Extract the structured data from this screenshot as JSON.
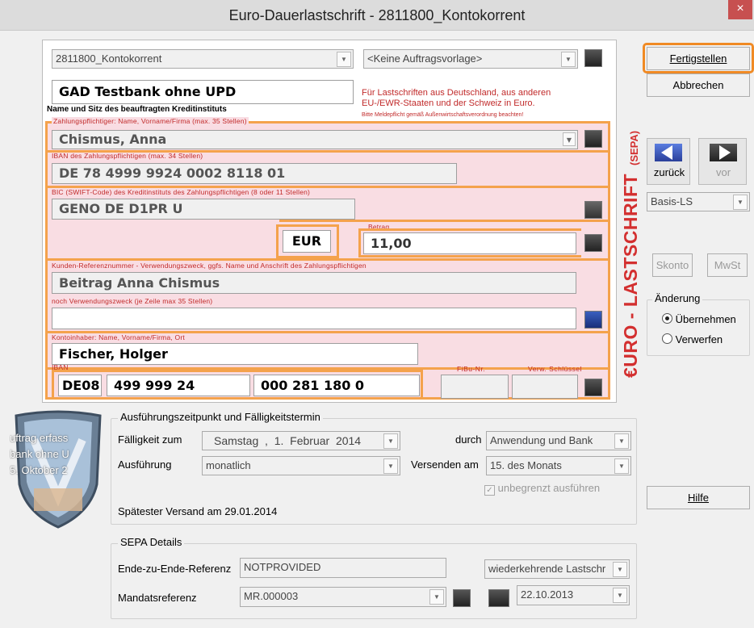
{
  "window": {
    "title": "Euro-Dauerlastschrift - 2811800_Kontokorrent",
    "close_label": "×"
  },
  "form": {
    "account_select": "2811800_Kontokorrent",
    "template_select": "<Keine Auftragsvorlage>",
    "bank_name": "GAD Testbank ohne UPD",
    "bank_label": "Name und Sitz des beauftragten Kreditinstituts",
    "info_line1": "Für Lastschriften aus Deutschland, aus anderen",
    "info_line2": "EU-/EWR-Staaten und der Schweiz in Euro.",
    "info_line3": "Bitte Meldepflicht gemäß Außenwirtschaftsverordnung beachten!",
    "payer_label": "Zahlungspflichtiger: Name, Vorname/Firma (max. 35 Stellen)",
    "payer_name": "Chismus, Anna",
    "iban_payer_label": "IBAN des Zahlungspflichtigen (max. 34 Stellen)",
    "iban_payer": "DE 78 4999 9924 0002 8118 01",
    "bic_label": "BIC (SWIFT-Code) des Kreditinstituts des Zahlungspflichtigen (8 oder 11 Stellen)",
    "bic": "GENO DE D1PR U",
    "currency": "EUR",
    "amount_label": "Betrag",
    "amount": "11,00",
    "ref_label": "Kunden-Referenznummer - Verwendungszweck, ggfs. Name und Anschrift des Zahlungspflichtigen",
    "ref_value": "Beitrag Anna Chismus",
    "purpose2_label": "noch Verwendungszweck (je Zeile max 35 Stellen)",
    "purpose2_value": "",
    "holder_label": "Kontoinhaber: Name, Vorname/Firma, Ort",
    "holder_value": "Fischer, Holger",
    "iban_label": "IBAN",
    "iban_part1": "DE08",
    "iban_part2": "499 999 24",
    "iban_part3": "000 281 180 0",
    "fibu_label": "FiBu-Nr.",
    "verw_label": "Verw. Schlüssel",
    "vertical_title": "€URO - LASTSCHRIFT",
    "vertical_sepa": "(SEPA)"
  },
  "right": {
    "finish_label": "Fertigstellen",
    "cancel_label": "Abbrechen",
    "back_label": "zurück",
    "next_label": "vor",
    "type_select": "Basis-LS",
    "skonto_label": "Skonto",
    "mwst_label": "MwSt",
    "change_legend": "Änderung",
    "radio_apply": "Übernehmen",
    "radio_discard": "Verwerfen",
    "help_label": "Hilfe"
  },
  "badge": {
    "line1": "uftrag erfass",
    "line2": "bank ohne U",
    "line3": "5. Oktober 2"
  },
  "execution": {
    "legend": "Ausführungszeitpunkt und Fälligkeitstermin",
    "due_label": "Fälligkeit zum",
    "due_value": "Samstag  ,  1.  Februar  2014",
    "through_label": "durch",
    "through_value": "Anwendung und Bank",
    "exec_label": "Ausführung",
    "exec_value": "monatlich",
    "send_label": "Versenden am",
    "send_value": "15. des Monats",
    "unlimited_label": "unbegrenzt ausführen",
    "latest_send": "Spätester Versand am 29.01.2014"
  },
  "sepa": {
    "legend": "SEPA Details",
    "e2e_label": "Ende-zu-Ende-Referenz",
    "e2e_value": "NOTPROVIDED",
    "type_value": "wiederkehrende Lastschr",
    "mandate_label": "Mandatsreferenz",
    "mandate_value": "MR.000003",
    "mandate_date": "22.10.2013"
  }
}
